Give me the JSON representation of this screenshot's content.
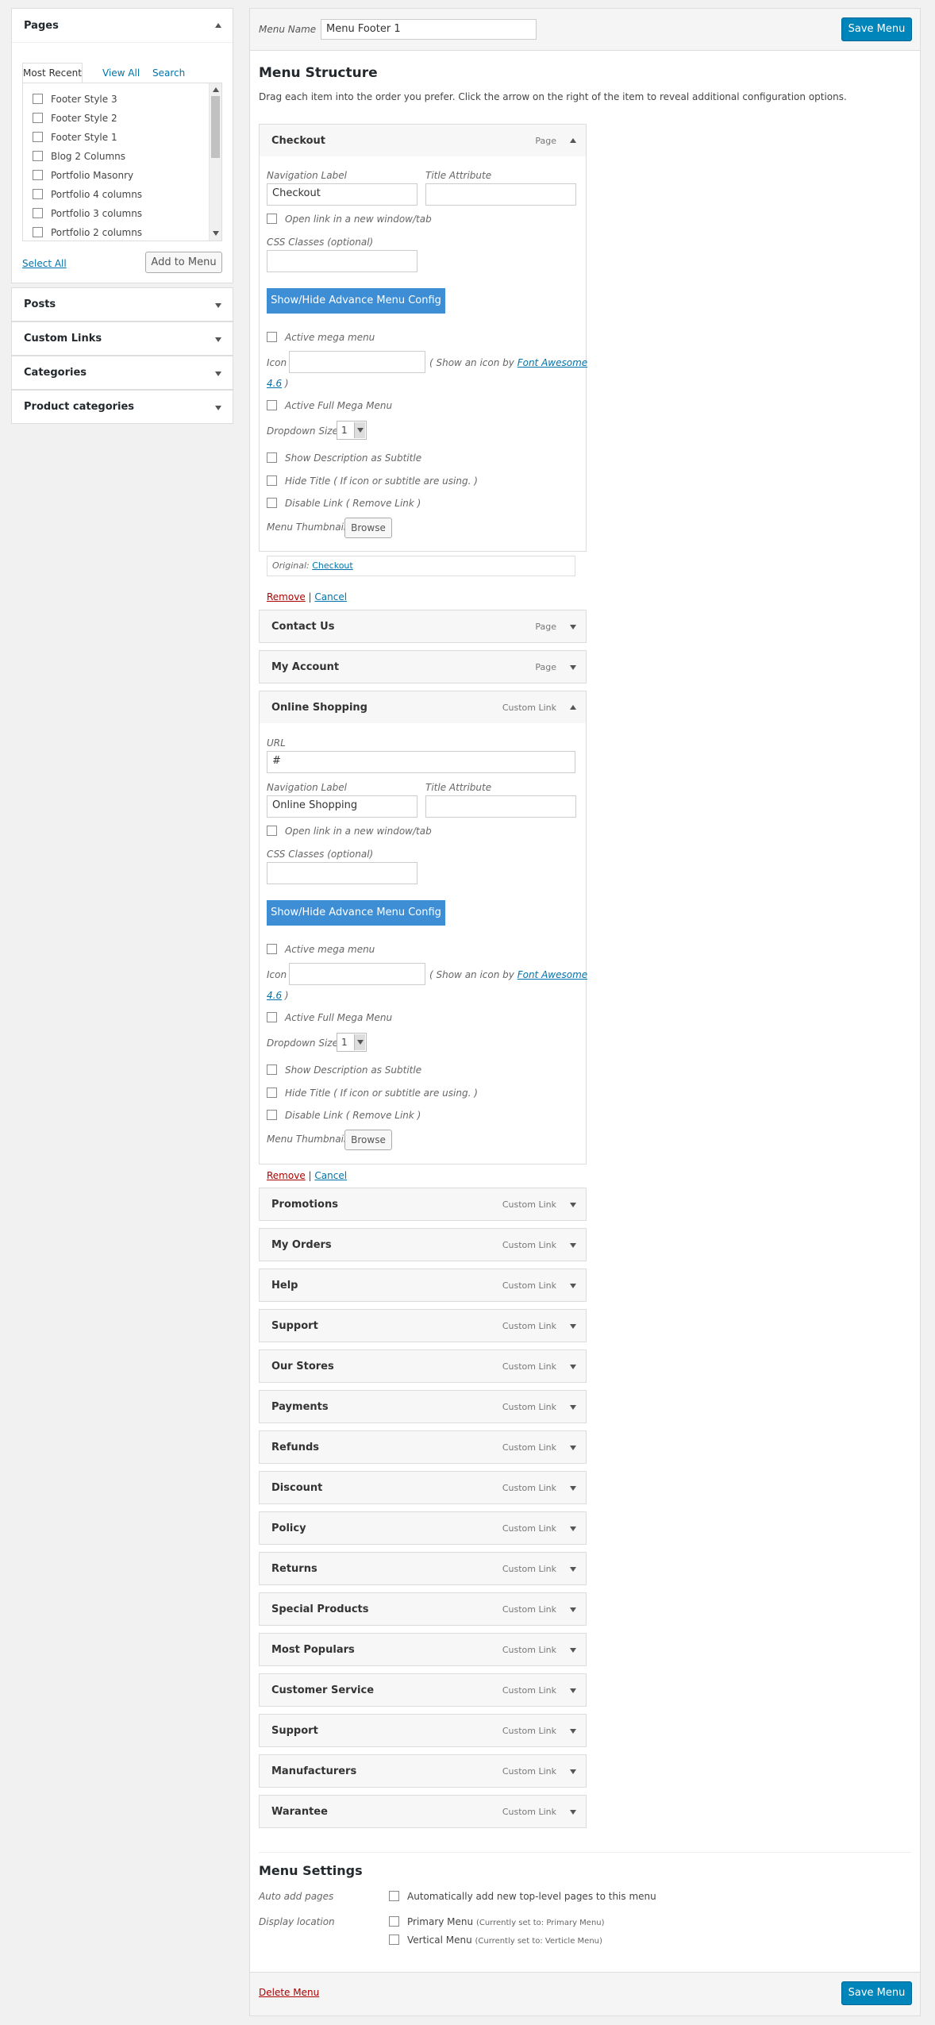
{
  "left": {
    "pages": {
      "title": "Pages",
      "tabs": [
        "Most Recent",
        "View All",
        "Search"
      ],
      "items": [
        "Footer Style 3",
        "Footer Style 2",
        "Footer Style 1",
        "Blog 2 Columns",
        "Portfolio Masonry",
        "Portfolio 4 columns",
        "Portfolio 3 columns",
        "Portfolio 2 columns"
      ],
      "select_all": "Select All",
      "add_to_menu": "Add to Menu"
    },
    "accordions": [
      "Posts",
      "Custom Links",
      "Categories",
      "Product categories"
    ]
  },
  "header": {
    "menu_name_label": "Menu Name",
    "menu_name_value": "Menu Footer 1",
    "save": "Save Menu"
  },
  "structure": {
    "title": "Menu Structure",
    "desc": "Drag each item into the order you prefer. Click the arrow on the right of the item to reveal additional configuration options."
  },
  "labels": {
    "nav_label": "Navigation Label",
    "title_attr": "Title Attribute",
    "new_window": "Open link in a new window/tab",
    "css_classes": "CSS Classes (optional)",
    "advance": "Show/Hide Advance Menu Config",
    "active_mega": "Active mega menu",
    "icon": "Icon",
    "icon_hint": "( Show an icon by",
    "font_awesome": "Font Awesome",
    "fa_version": "4.6",
    "fa_close": ")",
    "full_mega": "Active Full Mega Menu",
    "dropdown_size": "Dropdown Size",
    "dropdown_value": "1",
    "show_desc": "Show Description as Subtitle",
    "hide_title": "Hide Title ( If icon or subtitle are using. )",
    "disable_link": "Disable Link ( Remove Link )",
    "thumbnail": "Menu Thumbnail",
    "browse": "Browse",
    "original": "Original:",
    "remove": "Remove",
    "sep": "|",
    "cancel": "Cancel",
    "url": "URL",
    "url_value": "#"
  },
  "items": [
    {
      "title": "Checkout",
      "type": "Page",
      "nav_value": "Checkout",
      "original_link": "Checkout"
    },
    {
      "title": "Contact Us",
      "type": "Page"
    },
    {
      "title": "My Account",
      "type": "Page"
    },
    {
      "title": "Online Shopping",
      "type": "Custom Link",
      "nav_value": "Online Shopping"
    },
    {
      "title": "Promotions",
      "type": "Custom Link"
    },
    {
      "title": "My Orders",
      "type": "Custom Link"
    },
    {
      "title": "Help",
      "type": "Custom Link"
    },
    {
      "title": "Support",
      "type": "Custom Link"
    },
    {
      "title": "Our Stores",
      "type": "Custom Link"
    },
    {
      "title": "Payments",
      "type": "Custom Link"
    },
    {
      "title": "Refunds",
      "type": "Custom Link"
    },
    {
      "title": "Discount",
      "type": "Custom Link"
    },
    {
      "title": "Policy",
      "type": "Custom Link"
    },
    {
      "title": "Returns",
      "type": "Custom Link"
    },
    {
      "title": "Special Products",
      "type": "Custom Link"
    },
    {
      "title": "Most Populars",
      "type": "Custom Link"
    },
    {
      "title": "Customer Service",
      "type": "Custom Link"
    },
    {
      "title": "Support",
      "type": "Custom Link"
    },
    {
      "title": "Manufacturers",
      "type": "Custom Link"
    },
    {
      "title": "Warantee",
      "type": "Custom Link"
    }
  ],
  "settings": {
    "title": "Menu Settings",
    "auto_add": "Auto add pages",
    "auto_add_text": "Automatically add new top-level pages to this menu",
    "display_location": "Display location",
    "primary": "Primary Menu",
    "primary_note": "(Currently set to: Primary Menu)",
    "vertical": "Vertical Menu",
    "vertical_note": "(Currently set to: Verticle Menu)"
  },
  "footer": {
    "delete": "Delete Menu",
    "save": "Save Menu"
  }
}
